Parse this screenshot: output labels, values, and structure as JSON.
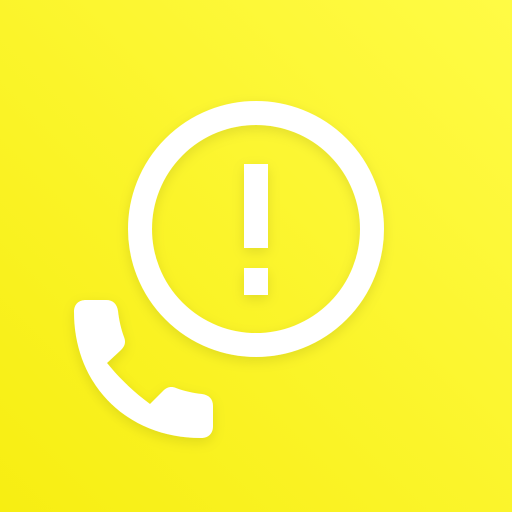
{
  "icon": {
    "name": "missed-call-alert",
    "glyphs": [
      "alert-circle-icon",
      "exclamation-icon",
      "phone-handset-icon"
    ],
    "colors": {
      "background_top": "#FFFB45",
      "background_bottom": "#F7EE12",
      "glyph": "#FFFFFF"
    }
  }
}
